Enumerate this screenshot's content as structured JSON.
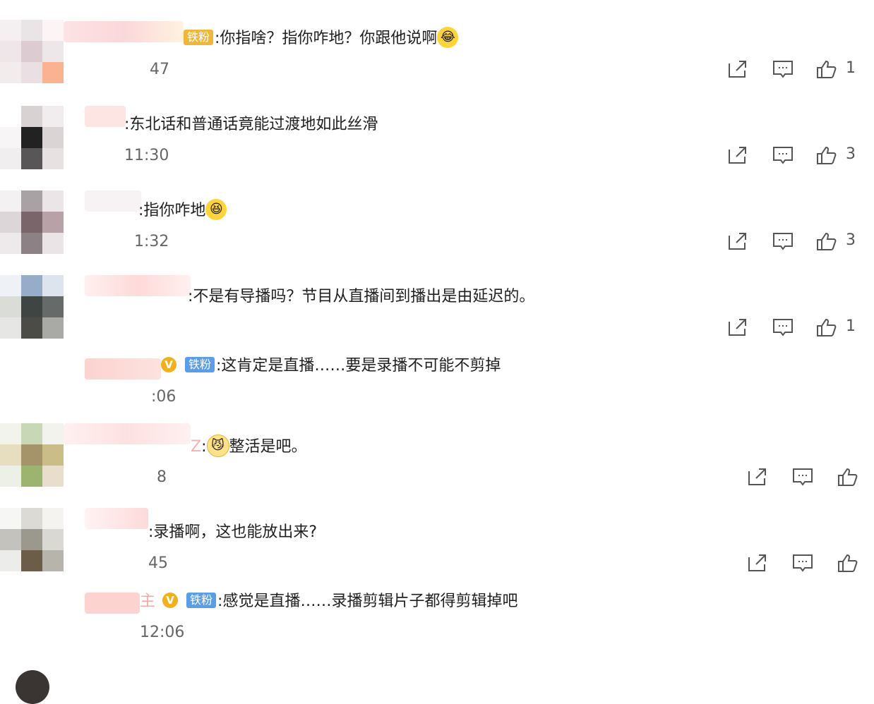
{
  "comments": [
    {
      "text": ":你指啥？指你咋地？你跟他说啊",
      "badge": "铁粉",
      "time": "47",
      "likes": "1",
      "emoji": "laugh-cry"
    },
    {
      "text": ":东北话和普通话竟能过渡地如此丝滑",
      "time": "11:30",
      "likes": "3"
    },
    {
      "text": ":指你咋地",
      "time": "1:32",
      "likes": "3",
      "emoji": "grin"
    },
    {
      "text": ":不是有导播吗？节目从直播间到播出是由延迟的。",
      "time": "",
      "likes": "1"
    },
    {
      "text": ":这肯定是直播……要是录播不可能不剪掉",
      "badge": "铁粉",
      "vip": "V",
      "time": ":06",
      "reply": true
    },
    {
      "text": "整活是吧。",
      "name_suffix": "Z",
      "time": "8",
      "likes": "",
      "emoji": "cat-face"
    },
    {
      "text": ":录播啊，这也能放出来?",
      "time": "45",
      "likes": ""
    },
    {
      "text": ":感觉是直播……录播剪辑片子都得剪辑掉吧",
      "badge": "铁粉",
      "vip": "V",
      "name_suffix": "主",
      "time": "12:06",
      "reply": true
    }
  ],
  "icons": {
    "share": "share-icon",
    "reply": "comment-icon",
    "like": "thumbs-up-icon"
  },
  "colors": {
    "vip": "#f2b11c",
    "badge_blue": "#5a9ee8",
    "badge_gold": "#f0b63a",
    "text": "#1f1f1f",
    "meta": "#666666"
  }
}
